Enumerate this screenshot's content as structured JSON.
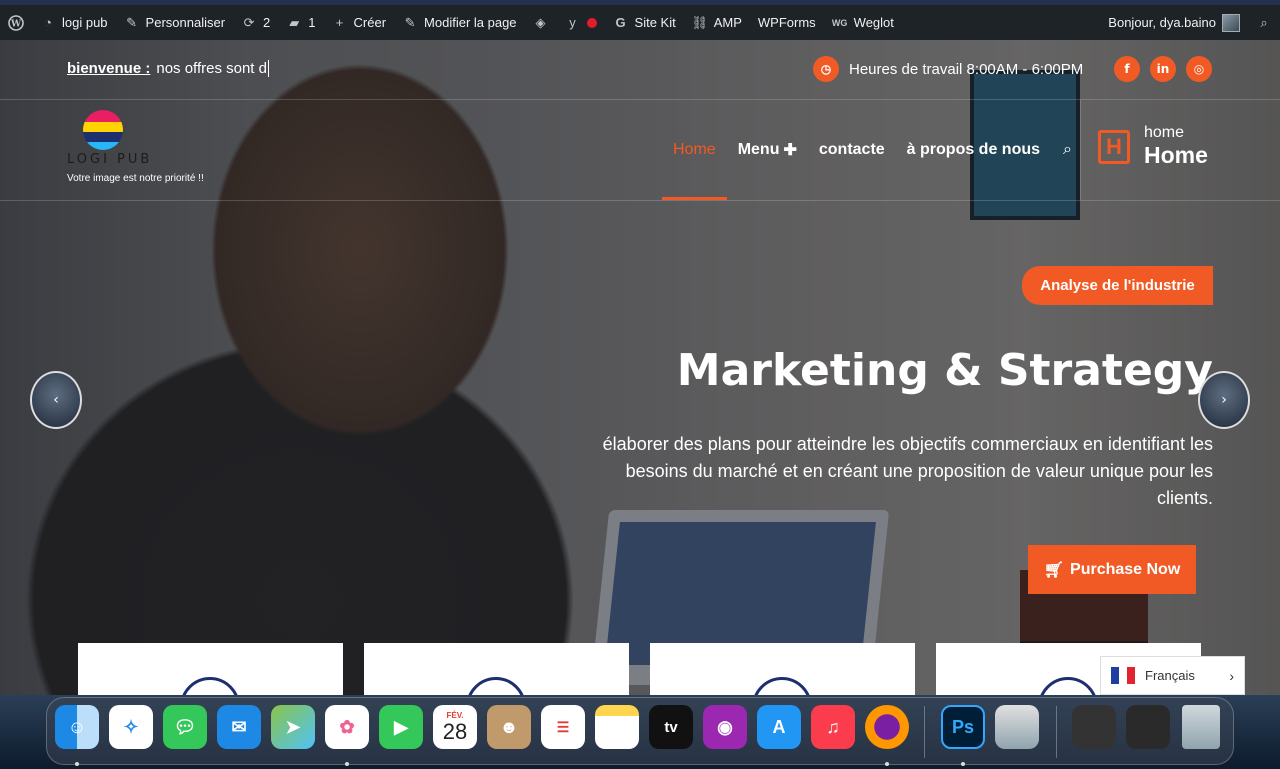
{
  "adminbar": {
    "site_name": "logi pub",
    "customize": "Personnaliser",
    "updates_count": "2",
    "comments_count": "1",
    "create": "Créer",
    "edit_page": "Modifier la page",
    "sitekit": "Site Kit",
    "amp": "AMP",
    "wpforms": "WPForms",
    "weglot": "Weglot",
    "greeting": "Bonjour, dya.baino"
  },
  "topbar": {
    "welcome_label": "bienvenue :",
    "welcome_text": "nos offres sont d",
    "hours": "Heures de travail 8:00AM - 6:00PM"
  },
  "logo": {
    "name": "LOGI PUB",
    "tagline": "Votre image est notre priorité !!"
  },
  "nav": {
    "items": [
      "Home",
      "Menu",
      "contacte",
      "à propos de nous"
    ],
    "home_small": "home",
    "home_big": "Home"
  },
  "slide": {
    "badge": "Analyse de l'industrie",
    "title": "Marketing & Strategy",
    "description": "élaborer des plans pour atteindre les objectifs commerciaux en identifiant les besoins du marché et en créant une proposition de valeur unique pour les clients.",
    "cta": "Purchase Now"
  },
  "language": {
    "selected": "Français"
  },
  "dock": {
    "calendar_month": "FÉV.",
    "calendar_day": "28",
    "tv_label": "tv",
    "ps_label": "Ps"
  },
  "colors": {
    "accent": "#f15a24",
    "adminbar": "#1d2327"
  }
}
